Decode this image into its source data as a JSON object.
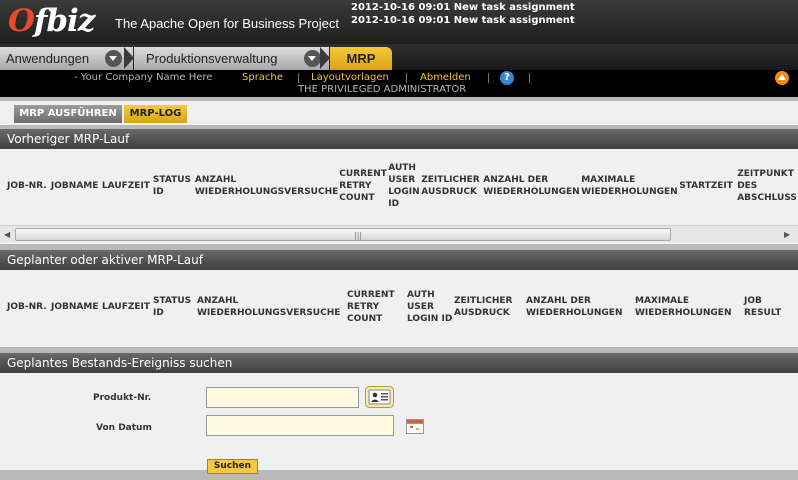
{
  "header": {
    "logo": "Ofbiz",
    "tagline": "The Apache Open for Business Project",
    "notifications": [
      "2012-10-16 09:01 New task assignment",
      "2012-10-16 09:01 New task assignment"
    ]
  },
  "tabs": {
    "app": "Anwendungen",
    "component": "Produktionsverwaltung",
    "active": "MRP"
  },
  "userbar": {
    "company": "- Your Company Name Here",
    "language": "Sprache",
    "layout": "Layoutvorlagen",
    "logout": "Abmelden",
    "help": "?",
    "user": "THE PRIVILEGED ADMINISTRATOR"
  },
  "subtabs": {
    "run": "MRP AUSFÜHREN",
    "log": "MRP-LOG"
  },
  "previous": {
    "title": "Vorheriger MRP-Lauf",
    "columns": [
      "JOB-NR.",
      "JOBNAME",
      "LAUFZEIT",
      "STATUS ID",
      "ANZAHL WIEDERHOLUNGSVERSUCHE",
      "CURRENT RETRY COUNT",
      "AUTH USER LOGIN ID",
      "ZEITLICHER AUSDRUCK",
      "ANZAHL DER WIEDERHOLUNGEN",
      "MAXIMALE WIEDERHOLUNGEN",
      "STARTZEIT",
      "ZEITPUNKT DES ABSCHLUSS"
    ]
  },
  "scheduled": {
    "title": "Geplanter oder aktiver MRP-Lauf",
    "columns": [
      "JOB-NR.",
      "JOBNAME",
      "LAUFZEIT",
      "STATUS ID",
      "ANZAHL WIEDERHOLUNGSVERSUCHE",
      "CURRENT RETRY COUNT",
      "AUTH USER LOGIN ID",
      "ZEITLICHER AUSDRUCK",
      "ANZAHL DER WIEDERHOLUNGEN",
      "MAXIMALE WIEDERHOLUNGEN",
      "JOB RESULT"
    ]
  },
  "search": {
    "title": "Geplantes Bestands-Ereigniss suchen",
    "product_label": "Produkt-Nr.",
    "product_value": "",
    "date_label": "Von Datum",
    "date_value": "",
    "submit": "Suchen"
  },
  "colors": {
    "accent": "#f2c335",
    "header": "#1e1e1e",
    "field_bg": "#fdfce1"
  }
}
